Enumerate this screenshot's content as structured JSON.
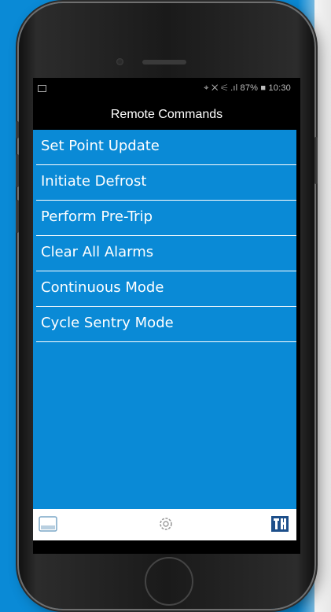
{
  "status_bar": {
    "left_icon": "image-notification-icon",
    "right_text": "87% ■ 10:30",
    "icons": [
      "location-icon",
      "wifi-icon",
      "signal-icon",
      "battery-icon"
    ]
  },
  "header": {
    "title": "Remote Commands"
  },
  "menu": {
    "items": [
      {
        "label": "Set Point Update"
      },
      {
        "label": "Initiate Defrost"
      },
      {
        "label": "Perform Pre-Trip"
      },
      {
        "label": "Clear All Alarms"
      },
      {
        "label": "Continuous Mode"
      },
      {
        "label": "Cycle Sentry Mode"
      }
    ]
  },
  "tab_bar": {
    "tabs": [
      {
        "name": "dashboard",
        "icon": "display-icon"
      },
      {
        "name": "settings",
        "icon": "gear-icon"
      },
      {
        "name": "unit",
        "icon": "thermo-logo-icon"
      }
    ]
  },
  "colors": {
    "accent": "#0a8ad6",
    "text_on_accent": "#ffffff",
    "phone_body": "#1a1a1a"
  }
}
